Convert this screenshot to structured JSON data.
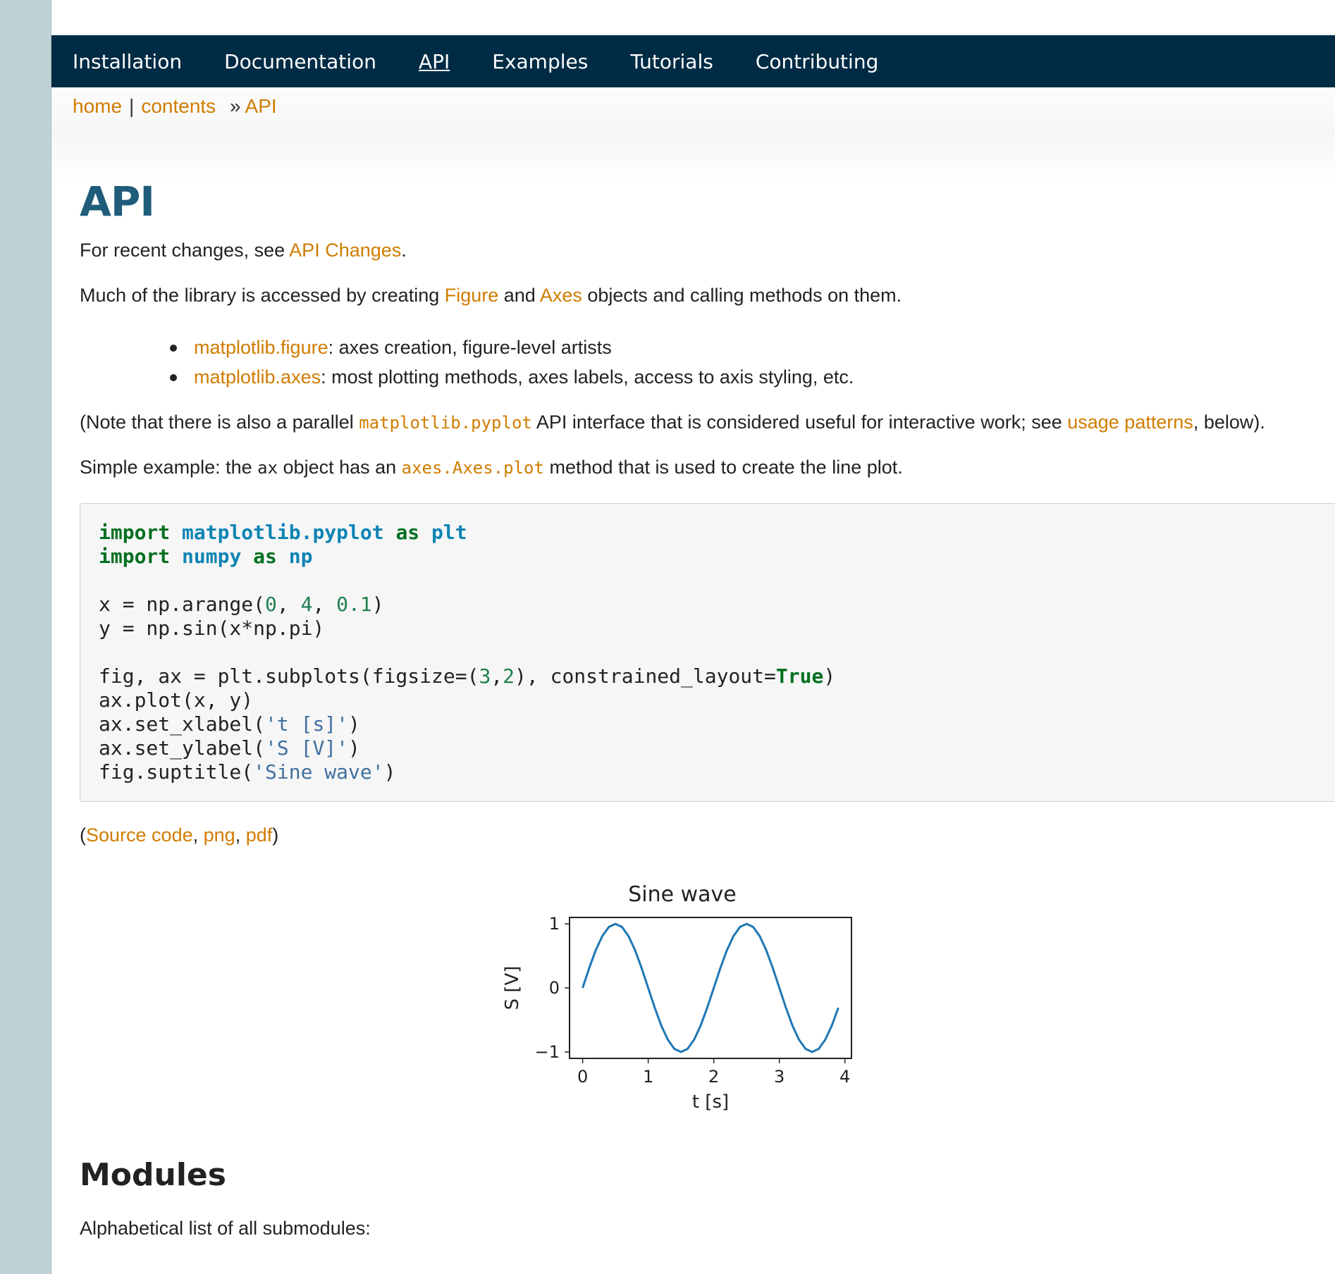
{
  "nav": {
    "items": [
      "Installation",
      "Documentation",
      "API",
      "Examples",
      "Tutorials",
      "Contributing"
    ],
    "active": "API"
  },
  "breadcrumb": {
    "home": "home",
    "pipe": "|",
    "contents": "contents",
    "arrow": "»",
    "current": "API"
  },
  "page": {
    "title": "API",
    "p1_prefix": "For recent changes, see ",
    "p1_link": "API Changes",
    "p1_suffix": ".",
    "p2_prefix": "Much of the library is accessed by creating ",
    "p2_link1": "Figure",
    "p2_mid": " and ",
    "p2_link2": "Axes",
    "p2_suffix": " objects and calling methods on them.",
    "bullets": [
      {
        "link": "matplotlib.figure",
        "text": ": axes creation, figure-level artists"
      },
      {
        "link": "matplotlib.axes",
        "text": ": most plotting methods, axes labels, access to axis styling, etc."
      }
    ],
    "p3_prefix": "(Note that there is also a parallel ",
    "p3_code": "matplotlib.pyplot",
    "p3_mid": " API interface that is considered useful for interactive work; see ",
    "p3_link": "usage patterns",
    "p3_suffix": ", below).",
    "p4_prefix": "Simple example: the ",
    "p4_code": "ax",
    "p4_mid": " object has an ",
    "p4_code2": "axes.Axes.plot",
    "p4_suffix": " method that is used to create the line plot.",
    "source_open": "(",
    "source_code": "Source code",
    "source_png": "png",
    "source_pdf": "pdf",
    "source_close": ")",
    "modules_heading": "Modules",
    "modules_text": "Alphabetical list of all submodules:"
  },
  "code": {
    "lines": [
      "import matplotlib.pyplot as plt",
      "import numpy as np",
      "",
      "x = np.arange(0, 4, 0.1)",
      "y = np.sin(x*np.pi)",
      "",
      "fig, ax = plt.subplots(figsize=(3,2), constrained_layout=True)",
      "ax.plot(x, y)",
      "ax.set_xlabel('t [s]')",
      "ax.set_ylabel('S [V]')",
      "fig.suptitle('Sine wave')"
    ]
  },
  "chart_data": {
    "type": "line",
    "title": "Sine wave",
    "xlabel": "t [s]",
    "ylabel": "S [V]",
    "xlim": [
      -0.2,
      4.1
    ],
    "ylim": [
      -1.1,
      1.1
    ],
    "xticks": [
      0,
      1,
      2,
      3,
      4
    ],
    "yticks": [
      -1,
      0,
      1
    ],
    "ytick_labels": [
      "−1",
      "0",
      "1"
    ],
    "grid": false,
    "line_color": "#1f77b4",
    "series": [
      {
        "x": [
          0.0,
          0.1,
          0.2,
          0.3,
          0.4,
          0.5,
          0.6,
          0.7,
          0.8,
          0.9,
          1.0,
          1.1,
          1.2,
          1.3,
          1.4,
          1.5,
          1.6,
          1.7,
          1.8,
          1.9,
          2.0,
          2.1,
          2.2,
          2.3,
          2.4,
          2.5,
          2.6,
          2.7,
          2.8,
          2.9,
          3.0,
          3.1,
          3.2,
          3.3,
          3.4,
          3.5,
          3.6,
          3.7,
          3.8,
          3.9
        ],
        "values": [
          0.0,
          0.309,
          0.588,
          0.809,
          0.951,
          1.0,
          0.951,
          0.809,
          0.588,
          0.309,
          0.0,
          -0.309,
          -0.588,
          -0.809,
          -0.951,
          -1.0,
          -0.951,
          -0.809,
          -0.588,
          -0.309,
          0.0,
          0.309,
          0.588,
          0.809,
          0.951,
          1.0,
          0.951,
          0.809,
          0.588,
          0.309,
          0.0,
          -0.309,
          -0.588,
          -0.809,
          -0.951,
          -1.0,
          -0.951,
          -0.809,
          -0.588,
          -0.309
        ]
      }
    ]
  },
  "colors": {
    "nav_bg": "#002b45",
    "link": "#d07c00",
    "title": "#1f5c7a"
  }
}
